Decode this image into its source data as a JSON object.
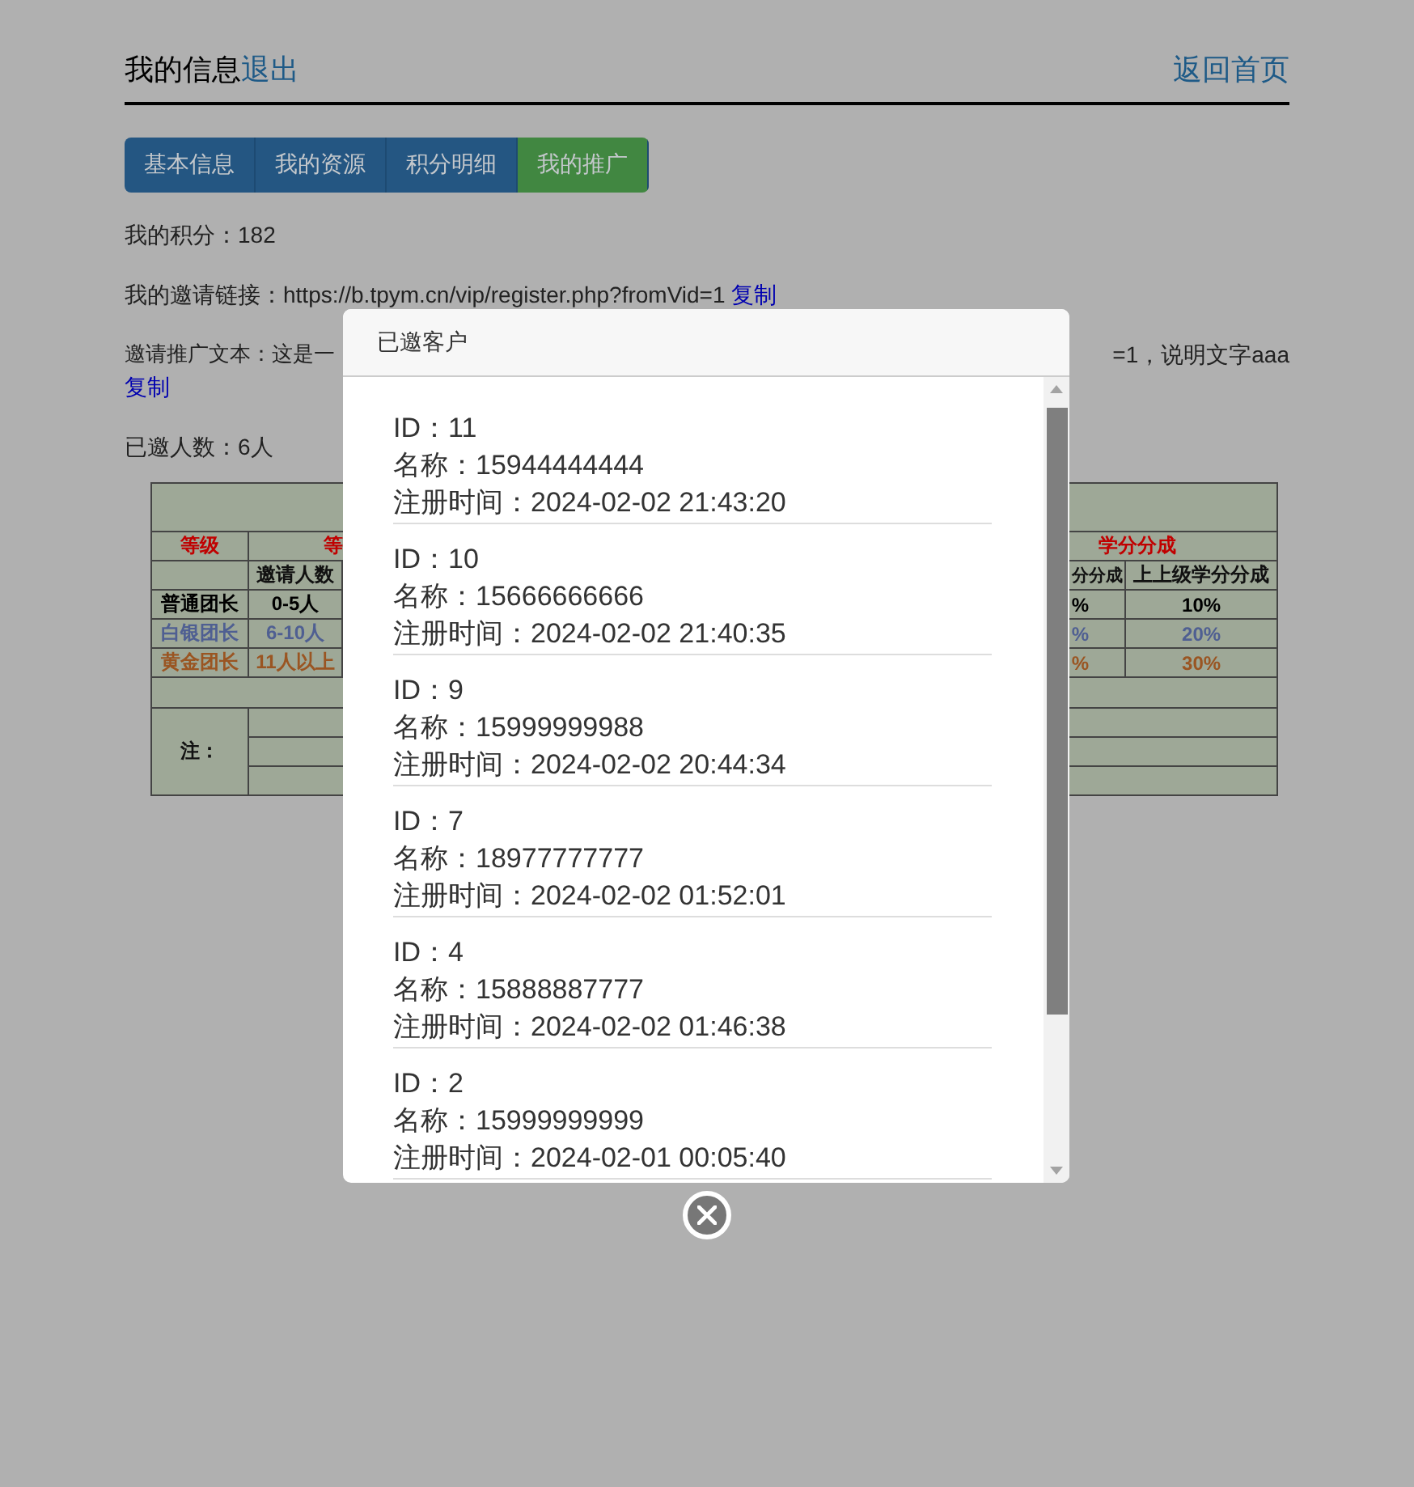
{
  "header": {
    "title": "我的信息",
    "logout_link": "退出",
    "home_link": "返回首页"
  },
  "tabs": [
    {
      "label": "基本信息",
      "selected": false
    },
    {
      "label": "我的资源",
      "selected": false
    },
    {
      "label": "积分明细",
      "selected": false
    },
    {
      "label": "我的推广",
      "selected": true
    }
  ],
  "info": {
    "points": "我的积分：182",
    "invite_link": {
      "text": "我的邀请链接：https://b.tpym.cn/vip/register.php?fromVid=1",
      "copy": "复制"
    },
    "promo_text": {
      "start": "邀请推广文本：这是一",
      "end": "=1，说明文字aaa",
      "copy": "复制"
    },
    "invited_count": "已邀人数：6人"
  },
  "level_table": {
    "level_header": "等级",
    "condition_header": "等",
    "share_header": "学分分成",
    "invites_header": "邀请人数",
    "share_col_header": "分分成",
    "upper_share_header": "上上级学分分成",
    "note": "注：",
    "rows": [
      {
        "level": "普通团长",
        "invites": "0-5人",
        "share": "%",
        "upper_share": "10%",
        "color": "#000000"
      },
      {
        "level": "白银团长",
        "invites": "6-10人",
        "share": "%",
        "upper_share": "20%",
        "color": "#4f5f92"
      },
      {
        "level": "黄金团长",
        "invites": "11人以上",
        "share": "%",
        "upper_share": "30%",
        "color": "#9a5522"
      }
    ]
  },
  "modal": {
    "title": "已邀客户",
    "customers": [
      {
        "id": "ID：11",
        "name": "名称：15944444444",
        "registered": "注册时间：2024-02-02 21:43:20"
      },
      {
        "id": "ID：10",
        "name": "名称：15666666666",
        "registered": "注册时间：2024-02-02 21:40:35"
      },
      {
        "id": "ID：9",
        "name": "名称：15999999988",
        "registered": "注册时间：2024-02-02 20:44:34"
      },
      {
        "id": "ID：7",
        "name": "名称：18977777777",
        "registered": "注册时间：2024-02-02 01:52:01"
      },
      {
        "id": "ID：4",
        "name": "名称：15888887777",
        "registered": "注册时间：2024-02-02 01:46:38"
      },
      {
        "id": "ID：2",
        "name": "名称：15999999999",
        "registered": "注册时间：2024-02-01 00:05:40"
      }
    ]
  }
}
